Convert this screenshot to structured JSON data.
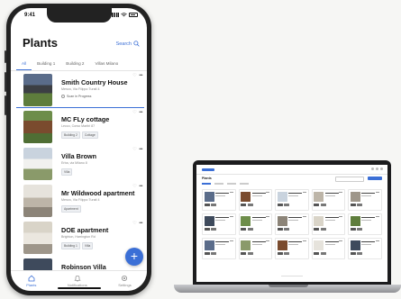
{
  "phone": {
    "status": {
      "time": "9:41"
    },
    "title": "Plants",
    "search_label": "Search",
    "tabs": [
      "All",
      "Building 1",
      "Building 2",
      "Villas Milano"
    ],
    "plants": [
      {
        "name": "Smith Country House",
        "address": "Menzo, Via Filippo Turati 4",
        "status": "Scan in Progress",
        "tags": []
      },
      {
        "name": "MC FLy cottage",
        "address": "Lecco, Corso Martiri 87",
        "tags": [
          "Building 2",
          "Cottage"
        ]
      },
      {
        "name": "Villa Brown",
        "address": "Erba, via Milano 8",
        "tags": [
          "Villa"
        ]
      },
      {
        "name": "Mr Wildwood apartment",
        "address": "Menzo, Via Filippo Turati 4",
        "tags": [
          "Apartment"
        ]
      },
      {
        "name": "DOE apartment",
        "address": "Brighton, Harrington Rd",
        "tags": [
          "Building 1",
          "Villa"
        ]
      },
      {
        "name": "Robinson Villa",
        "address": "Cleaver, 56 Mill Rd",
        "tags": []
      }
    ],
    "fab_label": "+",
    "bottom_nav": [
      "Plants",
      "Notifications",
      "Settings"
    ]
  },
  "laptop": {
    "title": "Plants"
  },
  "colors": {
    "accent": "#3b6fd6",
    "phone_frame": "#222222",
    "laptop_frame": "#1c1c1e"
  }
}
